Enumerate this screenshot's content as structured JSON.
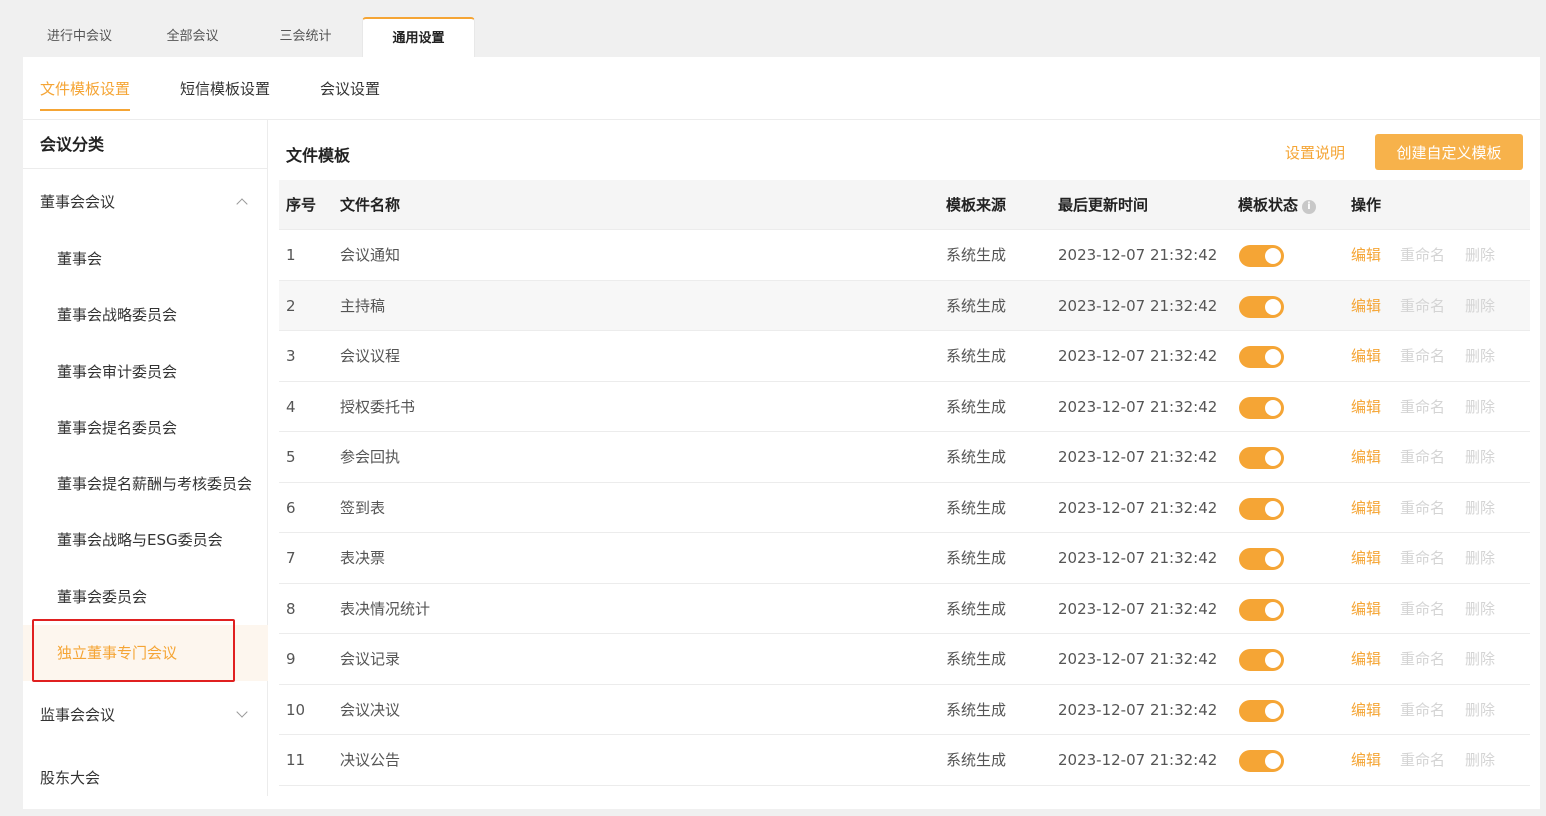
{
  "top_tabs": [
    "进行中会议",
    "全部会议",
    "三会统计",
    "通用设置"
  ],
  "sub_tabs": [
    "文件模板设置",
    "短信模板设置",
    "会议设置"
  ],
  "sidebar": {
    "title": "会议分类",
    "groups": {
      "board": "董事会会议",
      "supervisory": "监事会会议",
      "shareholders": "股东大会"
    },
    "items": [
      "董事会",
      "董事会战略委员会",
      "董事会审计委员会",
      "董事会提名委员会",
      "董事会提名薪酬与考核委员会",
      "董事会战略与ESG委员会",
      "董事会委员会",
      "独立董事专门会议"
    ]
  },
  "content": {
    "title": "文件模板",
    "help_link": "设置说明",
    "create_button": "创建自定义模板"
  },
  "table": {
    "headers": {
      "index": "序号",
      "name": "文件名称",
      "source": "模板来源",
      "updated": "最后更新时间",
      "status": "模板状态",
      "actions": "操作"
    },
    "info_icon": "i",
    "actions": {
      "edit": "编辑",
      "rename": "重命名",
      "delete": "删除"
    },
    "rows": [
      {
        "index": "1",
        "name": "会议通知",
        "source": "系统生成",
        "updated": "2023-12-07 21:32:42",
        "enabled": true
      },
      {
        "index": "2",
        "name": "主持稿",
        "source": "系统生成",
        "updated": "2023-12-07 21:32:42",
        "enabled": true
      },
      {
        "index": "3",
        "name": "会议议程",
        "source": "系统生成",
        "updated": "2023-12-07 21:32:42",
        "enabled": true
      },
      {
        "index": "4",
        "name": "授权委托书",
        "source": "系统生成",
        "updated": "2023-12-07 21:32:42",
        "enabled": true
      },
      {
        "index": "5",
        "name": "参会回执",
        "source": "系统生成",
        "updated": "2023-12-07 21:32:42",
        "enabled": true
      },
      {
        "index": "6",
        "name": "签到表",
        "source": "系统生成",
        "updated": "2023-12-07 21:32:42",
        "enabled": true
      },
      {
        "index": "7",
        "name": "表决票",
        "source": "系统生成",
        "updated": "2023-12-07 21:32:42",
        "enabled": true
      },
      {
        "index": "8",
        "name": "表决情况统计",
        "source": "系统生成",
        "updated": "2023-12-07 21:32:42",
        "enabled": true
      },
      {
        "index": "9",
        "name": "会议记录",
        "source": "系统生成",
        "updated": "2023-12-07 21:32:42",
        "enabled": true
      },
      {
        "index": "10",
        "name": "会议决议",
        "source": "系统生成",
        "updated": "2023-12-07 21:32:42",
        "enabled": true
      },
      {
        "index": "11",
        "name": "决议公告",
        "source": "系统生成",
        "updated": "2023-12-07 21:32:42",
        "enabled": true
      }
    ]
  },
  "colors": {
    "accent": "#f5a535",
    "button": "#f7b24b",
    "highlight_border": "#e02020"
  },
  "icons": {
    "expand": "chevron-up-icon",
    "collapse": "chevron-down-icon",
    "status_info": "info-icon"
  }
}
